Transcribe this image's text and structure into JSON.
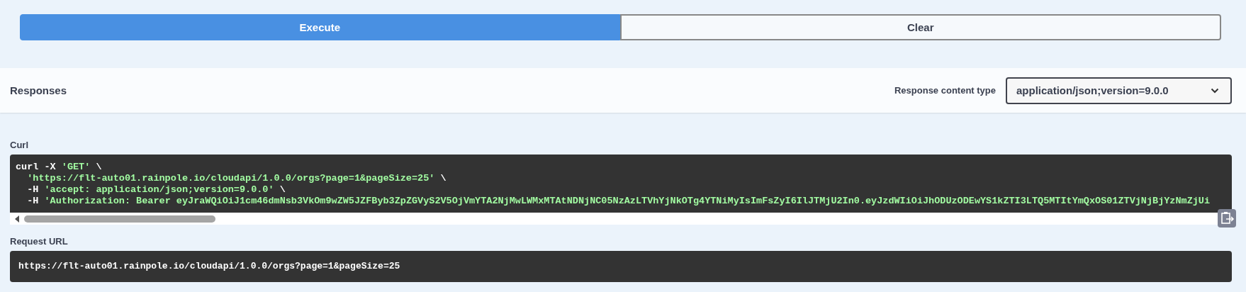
{
  "buttons": [
    {
      "label": "Execute",
      "kind": "primary"
    },
    {
      "label": "Clear",
      "kind": "secondary"
    }
  ],
  "responses": {
    "title": "Responses",
    "content_type_label": "Response content type",
    "content_type": "application/json;version=9.0.0"
  },
  "curl": {
    "label": "Curl",
    "lines": [
      {
        "indent": false,
        "parts": [
          {
            "t": "curl -X ",
            "kind": "plain"
          },
          {
            "t": "'GET'",
            "kind": "string"
          },
          {
            "t": " \\",
            "kind": "plain"
          }
        ]
      },
      {
        "indent": true,
        "parts": [
          {
            "t": "'https://flt-auto01.rainpole.io/cloudapi/1.0.0/orgs?page=1&pageSize=25'",
            "kind": "string"
          },
          {
            "t": " \\",
            "kind": "plain"
          }
        ]
      },
      {
        "indent": true,
        "parts": [
          {
            "t": "-H ",
            "kind": "plain"
          },
          {
            "t": "'accept: application/json;version=9.0.0'",
            "kind": "string"
          },
          {
            "t": " \\",
            "kind": "plain"
          }
        ]
      },
      {
        "indent": true,
        "parts": [
          {
            "t": "-H ",
            "kind": "plain"
          },
          {
            "t": "'Authorization: Bearer eyJraWQiOiJ1cm46dmNsb3VkOm9wZW5JZFByb3ZpZGVyS2V5OjVmYTA2NjMwLWMxMTAtNDNjNC05NzAzLTVhYjNkOTg4YTNiMyIsImFsZyI6IlJTMjU2In0.eyJzdWIiOiJhODUzODEwYS1kZTI3LTQ5MTItYmQxOS01ZTVjNjBjYzNmZjUi",
            "kind": "string"
          }
        ]
      }
    ]
  },
  "request_url": {
    "label": "Request URL",
    "value": "https://flt-auto01.rainpole.io/cloudapi/1.0.0/orgs?page=1&pageSize=25"
  }
}
